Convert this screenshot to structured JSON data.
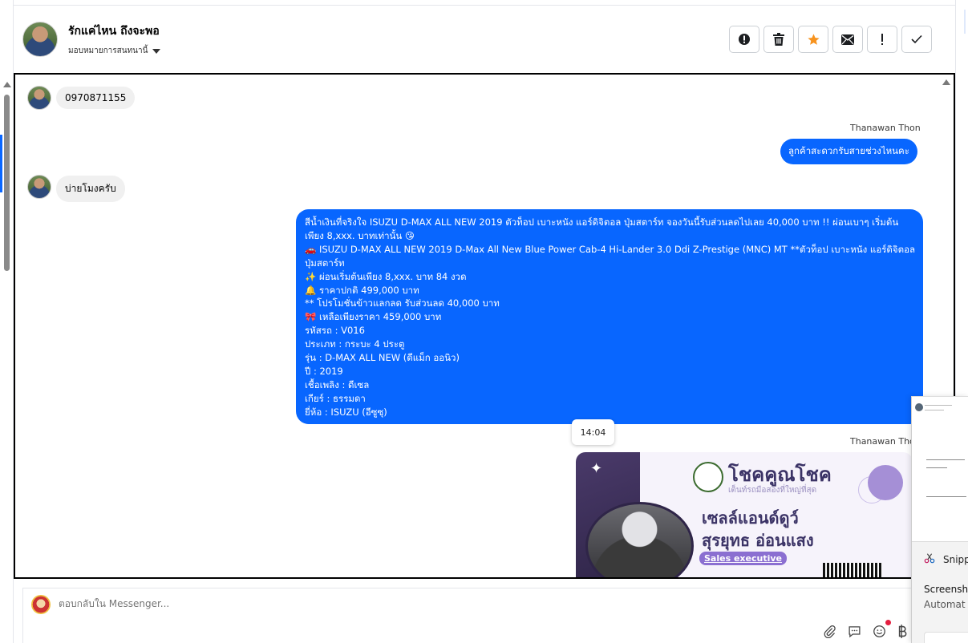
{
  "header": {
    "contact_name": "รักแค่ไหน ถึงจะพอ",
    "assign_label": "มอบหมายการสนทนานี้"
  },
  "actions": [
    {
      "name": "spam-button",
      "icon": "alert-circle-icon"
    },
    {
      "name": "delete-button",
      "icon": "trash-icon"
    },
    {
      "name": "star-button",
      "icon": "star-icon"
    },
    {
      "name": "mark-unread-button",
      "icon": "envelope-icon"
    },
    {
      "name": "follow-up-button",
      "icon": "exclamation-icon"
    },
    {
      "name": "done-button",
      "icon": "check-icon"
    }
  ],
  "messages": {
    "m1": "0970871155",
    "sender1": "Thanawan Thon",
    "m2": "ลูกค้าสะดวกรับสายช่วงไหนคะ",
    "m3": "บ่ายโมงครับ",
    "m4_lines": [
      "สีน้ำเงินที่จริงใจ ISUZU D-MAX ALL NEW 2019 ตัวท็อป เบาะหนัง แอร์ดิจิตอล ปุ่มสตาร์ท จองวันนี้รับส่วนลดไปเลย 40,000 บาท !! ผ่อนเบาๆ เริ่มต้น",
      "เพียง 8,xxx. บาทเท่านั้น 😘",
      "🚗 ISUZU D-MAX ALL NEW 2019 D-Max All New Blue Power Cab-4 Hi-Lander 3.0 Ddi Z-Prestige (MNC) MT **ตัวท็อป เบาะหนัง แอร์ดิจิตอล",
      "ปุ่มสตาร์ท",
      "✨ ผ่อนเริ่มต้นเพียง 8,xxx. บาท 84 งวด",
      "🔔 ราคาปกติ 499,000 บาท",
      "** โปรโมชั่นข้าวแลกลด รับส่วนลด 40,000 บาท",
      "🎀 เหลือเพียงราคา 459,000 บาท",
      "รหัสรถ : V016",
      "ประเภท : กระบะ 4 ประตู",
      "รุ่น : D-MAX ALL NEW (ดีแม็ก ออนิว)",
      "ปี : 2019",
      "เชื้อเพลิง : ดีเซล",
      "เกียร์ : ธรรมดา",
      "ยี่ห้อ : ISUZU (อีซูซุ)"
    ],
    "time_chip": "14:04",
    "sender2": "Thanawan Thon"
  },
  "image_card": {
    "brand": "โชคคูณโชค",
    "tagline": "เต็นท์รถมือสองที่ใหญ่ที่สุด",
    "role": "เซลล์แอนด์ดูว์",
    "person": "สุรยุทธ อ่อนแสง",
    "badge": "Sales executive"
  },
  "reply": {
    "placeholder": "ตอบกลับใน Messenger..."
  },
  "snip": {
    "title": "Snipp",
    "heading": "Screensh",
    "sub": "Automat"
  },
  "colors": {
    "accent": "#0866ff",
    "incoming_bubble": "#f0f0f0",
    "star": "#f7931e"
  }
}
